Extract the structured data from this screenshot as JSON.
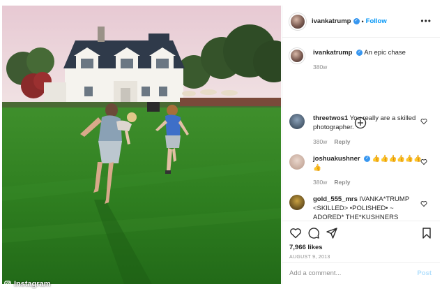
{
  "post": {
    "username": "ivankatrump",
    "follow_label": "Follow",
    "more_icon": "more-horizontal-icon",
    "caption_username": "ivankatrump",
    "caption_text": "An epic chase",
    "caption_time": "380w",
    "likes": "7,966 likes",
    "date": "AUGUST 9, 2013",
    "add_comment_placeholder": "Add a comment...",
    "post_label": "Post",
    "watermark": "Instagram"
  },
  "comments": [
    {
      "username": "threetwos1",
      "text": "You really are a skilled photographer.",
      "time": "380w",
      "reply_label": "Reply"
    },
    {
      "username": "joshuakushner",
      "text": "👍👍👍👍👍👍👍",
      "time": "380w",
      "reply_label": "Reply"
    },
    {
      "username": "gold_555_mrs",
      "text": "IVANKA*TRUMP <SKILLED> •POLISHED• ~ ADORED* THE*KUSHNERS",
      "time": "",
      "reply_label": ""
    }
  ],
  "colors": {
    "verified": "#3897f0",
    "follow": "#0095f6",
    "post_disabled": "#b2dffc",
    "grass": "#2e7d22",
    "sky": "#ead2d9"
  },
  "icons": [
    "verified-badge-icon",
    "plus-circle-icon",
    "heart-icon",
    "comment-icon",
    "share-icon",
    "bookmark-icon",
    "instagram-logo-icon"
  ]
}
